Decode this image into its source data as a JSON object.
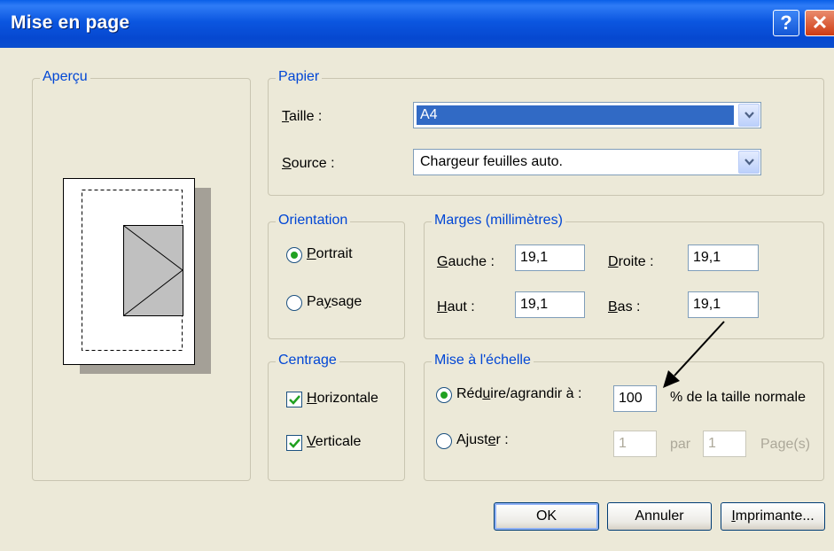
{
  "window": {
    "title": "Mise en page",
    "help_label": "?",
    "close_label": "✕"
  },
  "apercu": {
    "legend": "Aperçu"
  },
  "papier": {
    "legend": "Papier",
    "taille_label": {
      "key": "T",
      "rest": "aille :"
    },
    "taille_value": "A4",
    "source_label": {
      "key": "S",
      "rest": "ource :"
    },
    "source_value": "Chargeur feuilles auto."
  },
  "orientation": {
    "legend": "Orientation",
    "portrait": {
      "key": "P",
      "rest": "ortrait",
      "selected": true
    },
    "paysage": {
      "pre": "Pa",
      "key": "y",
      "rest": "sage",
      "selected": false
    }
  },
  "marges": {
    "legend": "Marges (millimètres)",
    "gauche": {
      "key": "G",
      "rest": "auche :",
      "value": "19,1"
    },
    "droite": {
      "key": "D",
      "rest": "roite :",
      "value": "19,1"
    },
    "haut": {
      "key": "H",
      "rest": "aut :",
      "value": "19,1"
    },
    "bas": {
      "key": "B",
      "rest": "as :",
      "value": "19,1"
    }
  },
  "centrage": {
    "legend": "Centrage",
    "horizontale": {
      "key": "H",
      "rest": "orizontale",
      "checked": true
    },
    "verticale": {
      "key": "V",
      "rest": "erticale",
      "checked": true
    }
  },
  "echelle": {
    "legend": "Mise à l'échelle",
    "reduire": {
      "pre": "Réd",
      "key": "u",
      "rest": "ire/agrandir à :",
      "selected": true
    },
    "reduire_value": "100",
    "taille_normale": "% de la taille normale",
    "ajuster": {
      "pre": "Ajust",
      "key": "e",
      "rest": "r :",
      "selected": false
    },
    "ajuster_width": "1",
    "par": "par",
    "ajuster_height": "1",
    "pages": "Page(s)"
  },
  "buttons": {
    "ok": "OK",
    "annuler": "Annuler",
    "imprimante": {
      "key": "I",
      "rest": "mprimante..."
    }
  },
  "colors": {
    "titlebar": "#0a4ecf",
    "legend": "#0046d5",
    "selection": "#316ac5",
    "dialog": "#ece9d8"
  },
  "icons": {
    "help": "question-mark-icon",
    "close": "close-x-icon",
    "dropdown": "chevron-down-icon",
    "radio": "radio-dot-icon",
    "check": "checkmark-icon",
    "annotation": "arrow-annotation"
  }
}
